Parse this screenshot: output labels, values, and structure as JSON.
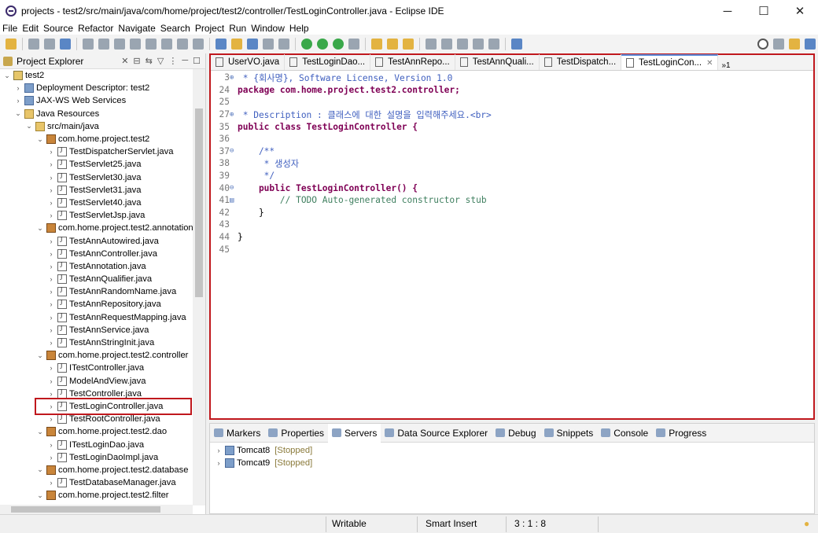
{
  "window": {
    "title": "projects - test2/src/main/java/com/home/project/test2/controller/TestLoginController.java - Eclipse IDE",
    "minimize": "─",
    "maximize": "☐",
    "close": "✕"
  },
  "menu": [
    "File",
    "Edit",
    "Source",
    "Refactor",
    "Navigate",
    "Search",
    "Project",
    "Run",
    "Window",
    "Help"
  ],
  "explorer": {
    "title": "Project Explorer",
    "items": [
      {
        "label": "test2",
        "icon": "project-icon"
      },
      {
        "label": "Deployment Descriptor: test2",
        "icon": "descriptor-icon"
      },
      {
        "label": "JAX-WS Web Services",
        "icon": "webservice-icon"
      },
      {
        "label": "Java Resources",
        "icon": "java-resources-icon"
      },
      {
        "label": "src/main/java",
        "icon": "source-folder-icon"
      },
      {
        "label": "com.home.project.test2",
        "icon": "package-icon"
      },
      {
        "label": "TestDispatcherServlet.java",
        "icon": "java-file-icon"
      },
      {
        "label": "TestServlet25.java",
        "icon": "java-file-icon"
      },
      {
        "label": "TestServlet30.java",
        "icon": "java-file-icon"
      },
      {
        "label": "TestServlet31.java",
        "icon": "java-file-icon"
      },
      {
        "label": "TestServlet40.java",
        "icon": "java-file-icon"
      },
      {
        "label": "TestServletJsp.java",
        "icon": "java-file-icon"
      },
      {
        "label": "com.home.project.test2.annotation",
        "icon": "package-icon"
      },
      {
        "label": "TestAnnAutowired.java",
        "icon": "java-file-icon"
      },
      {
        "label": "TestAnnController.java",
        "icon": "java-file-icon"
      },
      {
        "label": "TestAnnotation.java",
        "icon": "java-file-icon"
      },
      {
        "label": "TestAnnQualifier.java",
        "icon": "java-file-icon"
      },
      {
        "label": "TestAnnRandomName.java",
        "icon": "java-file-icon"
      },
      {
        "label": "TestAnnRepository.java",
        "icon": "java-file-icon"
      },
      {
        "label": "TestAnnRequestMapping.java",
        "icon": "java-file-icon"
      },
      {
        "label": "TestAnnService.java",
        "icon": "java-file-icon"
      },
      {
        "label": "TestAnnStringInit.java",
        "icon": "java-file-icon"
      },
      {
        "label": "com.home.project.test2.controller",
        "icon": "package-icon"
      },
      {
        "label": "ITestController.java",
        "icon": "java-file-icon"
      },
      {
        "label": "ModelAndView.java",
        "icon": "java-file-icon"
      },
      {
        "label": "TestController.java",
        "icon": "java-file-icon"
      },
      {
        "label": "TestLoginController.java",
        "icon": "java-file-icon"
      },
      {
        "label": "TestRootController.java",
        "icon": "java-file-icon"
      },
      {
        "label": "com.home.project.test2.dao",
        "icon": "package-icon"
      },
      {
        "label": "ITestLoginDao.java",
        "icon": "java-file-icon"
      },
      {
        "label": "TestLoginDaoImpl.java",
        "icon": "java-file-icon"
      },
      {
        "label": "com.home.project.test2.database",
        "icon": "package-icon"
      },
      {
        "label": "TestDatabaseManager.java",
        "icon": "java-file-icon"
      },
      {
        "label": "com.home.project.test2.filter",
        "icon": "package-icon"
      }
    ]
  },
  "editor": {
    "tabs": [
      "UserVO.java",
      "TestLoginDao...",
      "TestAnnRepo...",
      "TestAnnQuali...",
      "TestDispatch...",
      "TestLoginCon..."
    ],
    "more": "»1",
    "lines": [
      {
        "n": "3",
        "text": " * {회사명}, Software License, Version 1.0"
      },
      {
        "n": "24",
        "text": "package com.home.project.test2.controller;"
      },
      {
        "n": "25",
        "text": ""
      },
      {
        "n": "27",
        "text": " * Description : 클래스에 대한 설명을 입력해주세요.<br>"
      },
      {
        "n": "35",
        "text": "public class TestLoginController {"
      },
      {
        "n": "36",
        "text": ""
      },
      {
        "n": "37",
        "text": "    /**"
      },
      {
        "n": "38",
        "text": "     * 생성자"
      },
      {
        "n": "39",
        "text": "     */"
      },
      {
        "n": "40",
        "text": "    public TestLoginController() {"
      },
      {
        "n": "41",
        "text": "        // TODO Auto-generated constructor stub"
      },
      {
        "n": "42",
        "text": "    }"
      },
      {
        "n": "43",
        "text": ""
      },
      {
        "n": "44",
        "text": "}"
      },
      {
        "n": "45",
        "text": ""
      }
    ]
  },
  "bottom": {
    "tabs": [
      "Markers",
      "Properties",
      "Servers",
      "Data Source Explorer",
      "Debug",
      "Snippets",
      "Console",
      "Progress"
    ],
    "servers": [
      {
        "name": "Tomcat8",
        "status": "[Stopped]"
      },
      {
        "name": "Tomcat9",
        "status": "[Stopped]"
      }
    ]
  },
  "status": {
    "mode": "Writable",
    "insert": "Smart Insert",
    "position": "3 : 1 : 8"
  }
}
